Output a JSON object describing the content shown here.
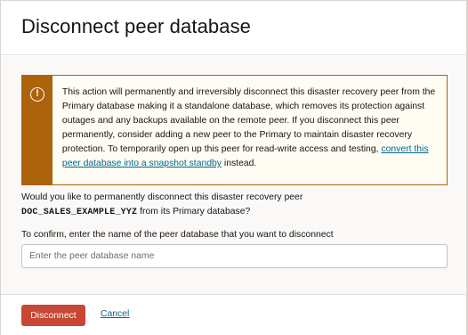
{
  "dialog": {
    "title": "Disconnect peer database"
  },
  "warning": {
    "icon": "warning-circle-icon",
    "text_before_link": "This action will permanently and irreversibly disconnect this disaster recovery peer from the Primary database making it a standalone database, which removes its protection against outages and any backups available on the remote peer. If you disconnect this peer permanently, consider adding a new peer to the Primary to maintain disaster recovery protection. To temporarily open up this peer for read-write access and testing, ",
    "link_text": "convert this peer database into a snapshot standby",
    "text_after_link": " instead.",
    "accent_color": "#ac630c"
  },
  "question": {
    "prefix": "Would you like to permanently disconnect this disaster recovery peer",
    "peer_name": "DOC_SALES_EXAMPLE_YYZ",
    "suffix": " from its Primary database?"
  },
  "confirm": {
    "label": "To confirm, enter the name of the peer database that you want to disconnect",
    "placeholder": "Enter the peer database name",
    "value": ""
  },
  "footer": {
    "disconnect_label": "Disconnect",
    "cancel_label": "Cancel",
    "danger_color": "#c74634"
  }
}
